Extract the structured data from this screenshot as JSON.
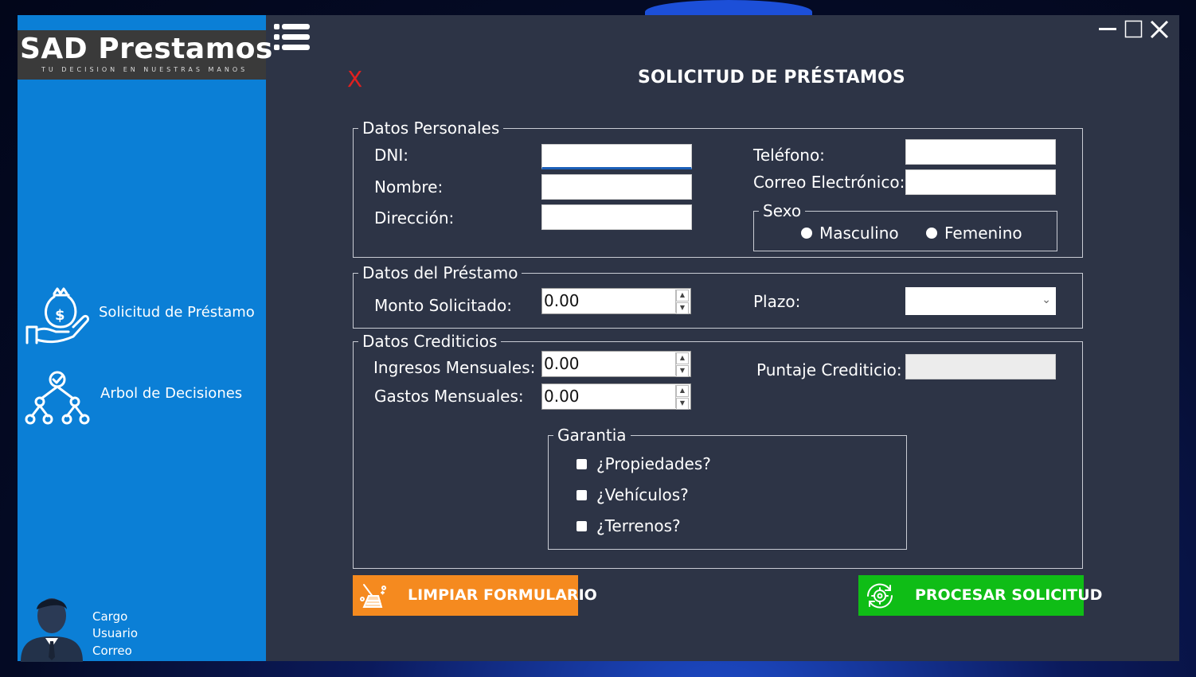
{
  "app": {
    "logo_title": "SAD Prestamos",
    "logo_subtitle": "TU DECISION EN NUESTRAS MANOS"
  },
  "sidebar": {
    "items": [
      {
        "label": "Solicitud de Préstamo",
        "icon": "money-bag-hand-icon"
      },
      {
        "label": "Arbol de Decisiones",
        "icon": "decision-tree-icon"
      }
    ],
    "user": {
      "cargo": "Cargo",
      "usuario": "Usuario",
      "correo": "Correo"
    }
  },
  "header": {
    "close_x": "X",
    "title": "SOLICITUD DE PRÉSTAMOS"
  },
  "personal": {
    "legend": "Datos Personales",
    "dni_label": "DNI:",
    "nombre_label": "Nombre:",
    "direccion_label": "Dirección:",
    "telefono_label": "Teléfono:",
    "correo_label": "Correo Electrónico:",
    "sexo": {
      "legend": "Sexo",
      "options": [
        "Masculino",
        "Femenino"
      ]
    }
  },
  "loan": {
    "legend": "Datos del Préstamo",
    "monto_label": "Monto Solicitado:",
    "monto_value": "0.00",
    "plazo_label": "Plazo:",
    "plazo_value": ""
  },
  "credit": {
    "legend": "Datos Crediticios",
    "ingresos_label": "Ingresos Mensuales:",
    "ingresos_value": "0.00",
    "gastos_label": "Gastos Mensuales:",
    "gastos_value": "0.00",
    "puntaje_label": "Puntaje Crediticio:",
    "garantia": {
      "legend": "Garantia",
      "options": [
        "¿Propiedades?",
        "¿Vehículos?",
        "¿Terrenos?"
      ]
    }
  },
  "buttons": {
    "clear_label": "LIMPIAR FORMULARIO",
    "process_label": "PROCESAR SOLICITUD"
  },
  "colors": {
    "sidebar": "#0b7fd6",
    "background": "#2d3446",
    "clear_button": "#f58a1f",
    "process_button": "#0fbd16",
    "close_x": "#e0201f"
  }
}
